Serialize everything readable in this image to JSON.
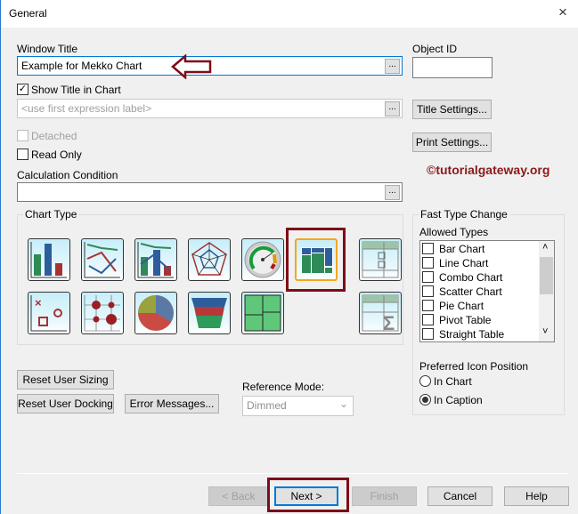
{
  "window": {
    "title": "General",
    "close": "×"
  },
  "window_title": {
    "label": "Window Title",
    "value": "Example for Mekko Chart",
    "button": "..."
  },
  "object_id": {
    "label": "Object ID",
    "value": ""
  },
  "show_title": {
    "label": "Show Title in Chart",
    "checked": true,
    "check": "✓"
  },
  "title_expr": {
    "placeholder": "<use first expression label>",
    "button": "..."
  },
  "title_settings": "Title Settings...",
  "detached": {
    "label": "Detached",
    "checked": false
  },
  "read_only": {
    "label": "Read Only",
    "checked": false
  },
  "print_settings": "Print Settings...",
  "watermark": "©tutorialgateway.org",
  "calc_condition": {
    "label": "Calculation Condition",
    "value": "",
    "button": "..."
  },
  "chart_type": {
    "label": "Chart Type",
    "selected": "mekko"
  },
  "fast_type": {
    "label": "Fast Type Change",
    "allowed_label": "Allowed Types",
    "items": [
      "Bar Chart",
      "Line Chart",
      "Combo Chart",
      "Scatter Chart",
      "Pie Chart",
      "Pivot Table",
      "Straight Table"
    ],
    "scroll_up": "˄",
    "scroll_down": "˅",
    "icon_pos_label": "Preferred Icon Position",
    "in_chart": "In Chart",
    "in_caption": "In Caption",
    "selected_pos": "In Caption"
  },
  "buttons": {
    "reset_sizing": "Reset User Sizing",
    "reset_docking": "Reset User Docking",
    "error_messages": "Error Messages...",
    "back": "< Back",
    "next": "Next >",
    "finish": "Finish",
    "cancel": "Cancel",
    "help": "Help"
  },
  "reference_mode": {
    "label": "Reference Mode:",
    "value": "Dimmed",
    "arrow": "⌄"
  },
  "colors": {
    "highlight": "#7d0d18",
    "focus": "#0078d7",
    "watermark": "#8b1a1a"
  }
}
